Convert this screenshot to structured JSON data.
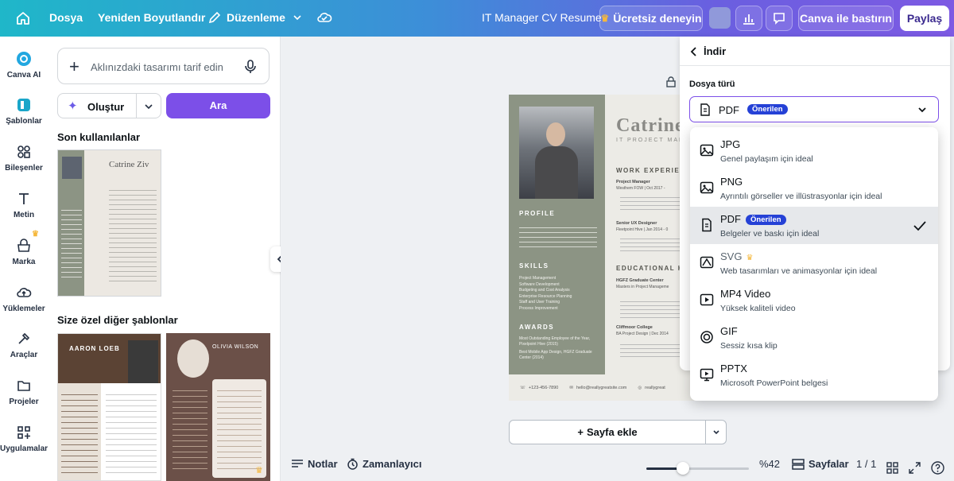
{
  "topbar": {
    "file": "Dosya",
    "resize": "Yeniden Boyutlandır",
    "edit": "Düzenleme",
    "title": "IT Manager CV Resume",
    "trial": "Ücretsiz deneyin",
    "print": "Canva ile bastırın",
    "share": "Paylaş"
  },
  "sidebar": [
    {
      "label": "Canva AI"
    },
    {
      "label": "Şablonlar"
    },
    {
      "label": "Bileşenler"
    },
    {
      "label": "Metin"
    },
    {
      "label": "Marka"
    },
    {
      "label": "Yüklemeler"
    },
    {
      "label": "Araçlar"
    },
    {
      "label": "Projeler"
    },
    {
      "label": "Uygulamalar"
    }
  ],
  "panel": {
    "prompt_placeholder": "Aklınızdaki tasarımı tarif edin",
    "create": "Oluştur",
    "search": "Ara",
    "recent_heading": "Son kullanılanlar",
    "more_heading": "Size özel diğer şablonlar"
  },
  "thumb1": {
    "name": "Catrine Ziv"
  },
  "thumb2": {
    "name": "AARON LOEB"
  },
  "thumb3": {
    "name": "OLIVIA WILSON"
  },
  "resume": {
    "name": "Catrine",
    "role": "IT PROJECT MANA",
    "work": "WORK EXPERIEN",
    "profile": "PROFILE",
    "skills": "SKILLS",
    "awards": "AWARDS",
    "education": "EDUCATIONAL H",
    "job1": "Project Manager",
    "job1sub": "Westhem FOW | Oct 2017 -",
    "job2": "Senior UX Designer",
    "job2sub": "Fleetpoint Hive | Jan 2014 - 0",
    "edu1": "HGFZ Graduate Center",
    "edu1sub": "Masters in Project Manageme",
    "edu2": "Cliffmoor College",
    "edu2sub": "BA Project Design | Dec 2014",
    "phone": "+123-456-7890",
    "email": "hello@reallygreatsite.com",
    "site": "reallygreat",
    "skill_items": [
      "Project Management",
      "Software Development",
      "Budgeting and Cost Analysis",
      "Enterprise Resource Planning",
      "Staff and User Training",
      "Process Improvement"
    ],
    "award_items": [
      "Most Outstanding Employee of the Year, Pixelpoint Hive (2015)",
      "Best Mobile App Design, HGFZ Graduate Center (2014)"
    ]
  },
  "add_page": "Sayfa ekle",
  "download": {
    "back": "İndir",
    "file_type_label": "Dosya türü",
    "selected": "PDF",
    "recommended": "Önerilen"
  },
  "formats": [
    {
      "name": "JPG",
      "desc": "Genel paylaşım için ideal",
      "icon": "image-icon"
    },
    {
      "name": "PNG",
      "desc": "Ayrıntılı görseller ve illüstrasyonlar için ideal",
      "icon": "image-icon"
    },
    {
      "name": "PDF",
      "desc": "Belgeler ve baskı için ideal",
      "icon": "document-icon",
      "badge": "Önerilen",
      "selected": true
    },
    {
      "name": "SVG",
      "desc": "Web tasarımları ve animasyonlar için ideal",
      "icon": "vector-icon",
      "premium": true
    },
    {
      "name": "MP4 Video",
      "desc": "Yüksek kaliteli video",
      "icon": "video-icon"
    },
    {
      "name": "GIF",
      "desc": "Sessiz kısa klip",
      "icon": "gif-icon"
    },
    {
      "name": "PPTX",
      "desc": "Microsoft PowerPoint belgesi",
      "icon": "presentation-icon"
    }
  ],
  "bottom": {
    "notes": "Notlar",
    "timer": "Zamanlayıcı",
    "zoom": "%42",
    "zoom_level": 0.42,
    "pages": "Sayfalar",
    "page_count": "1 / 1"
  }
}
